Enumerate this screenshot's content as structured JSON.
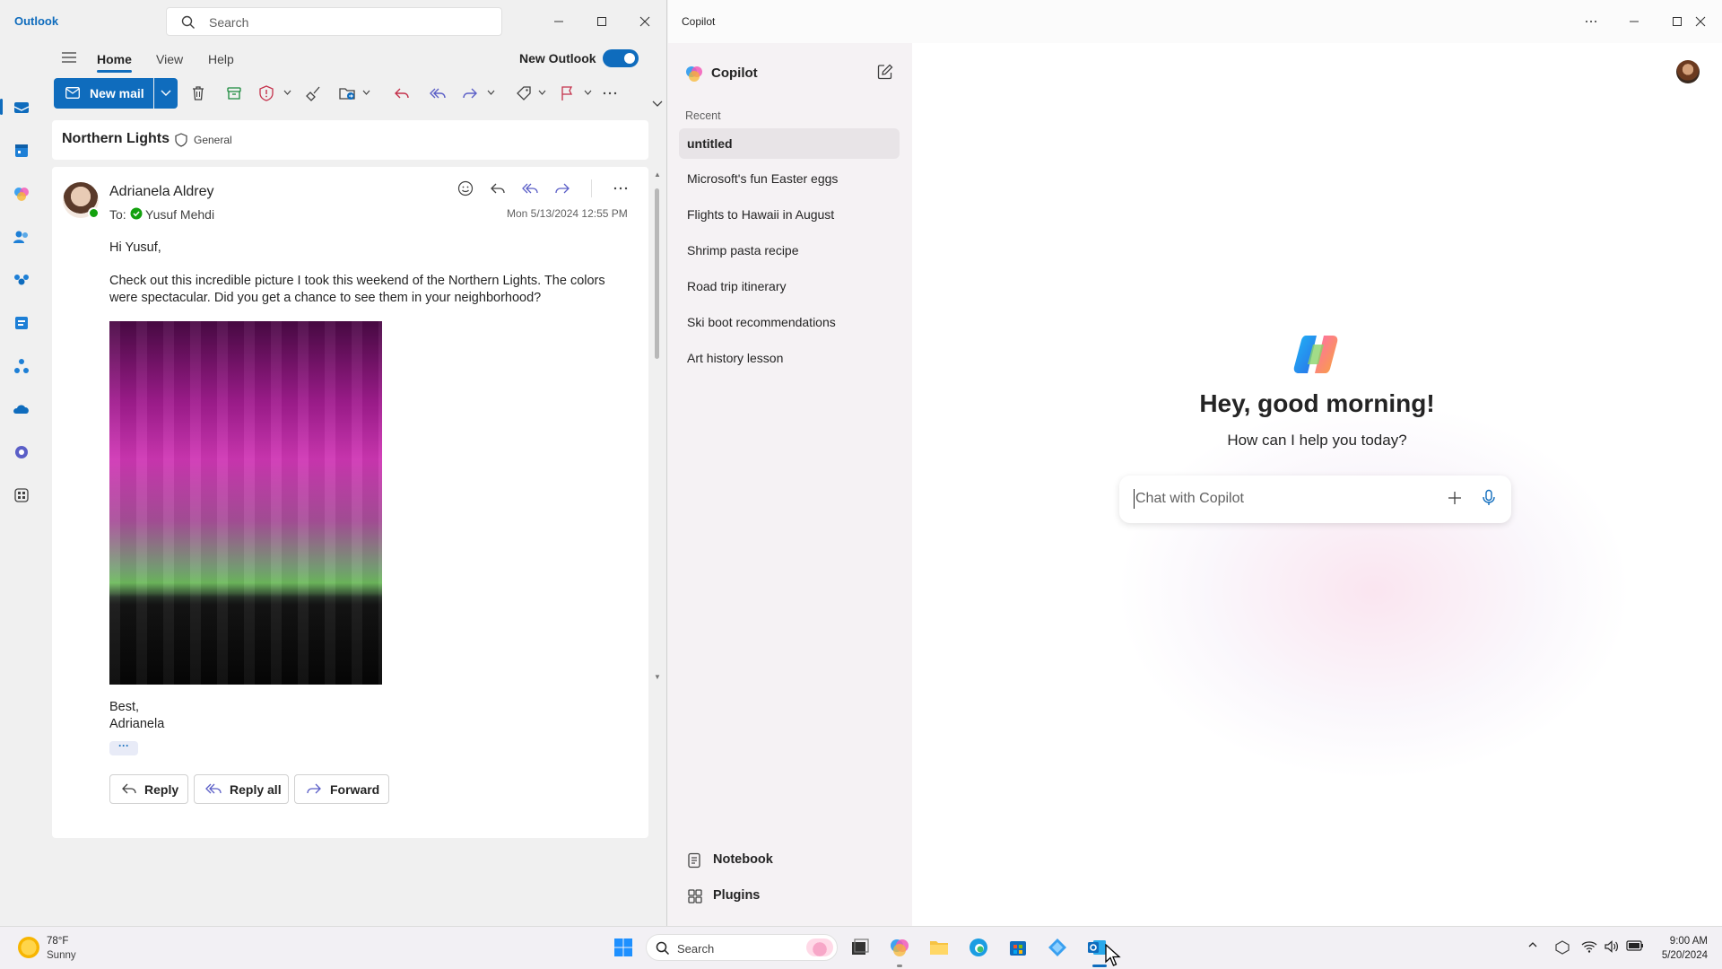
{
  "outlook": {
    "app_name": "Outlook",
    "search_placeholder": "Search",
    "tabs": [
      "Home",
      "View",
      "Help"
    ],
    "new_outlook_label": "New Outlook",
    "new_outlook_enabled": true,
    "new_mail_label": "New mail",
    "accent_color": "#0f6cbd",
    "subject": "Northern Lights",
    "sensitivity": "General",
    "message": {
      "sender": "Adrianela Aldrey",
      "to_label": "To:",
      "recipient": "Yusuf Mehdi",
      "date": "Mon 5/13/2024 12:55 PM",
      "greeting": "Hi Yusuf,",
      "body": "Check out this incredible picture I took this weekend of the Northern Lights. The colors were spectacular. Did you get a chance to see them in your neighborhood?",
      "signoff": "Best,",
      "signature": "Adrianela",
      "more": "···"
    },
    "actions": {
      "reply": "Reply",
      "reply_all": "Reply all",
      "forward": "Forward"
    }
  },
  "copilot": {
    "window_title": "Copilot",
    "brand": "Copilot",
    "recent_label": "Recent",
    "recent_items": [
      "untitled",
      "Microsoft's fun Easter eggs",
      "Flights to Hawaii in August",
      "Shrimp pasta recipe",
      "Road trip itinerary",
      "Ski boot recommendations",
      "Art history lesson"
    ],
    "notebook": "Notebook",
    "plugins": "Plugins",
    "greeting": "Hey, good morning!",
    "subgreeting": "How can I help you today?",
    "chat_placeholder": "Chat with Copilot"
  },
  "taskbar": {
    "weather_temp": "78°F",
    "weather_desc": "Sunny",
    "search_label": "Search",
    "time": "9:00 AM",
    "date": "5/20/2024"
  }
}
